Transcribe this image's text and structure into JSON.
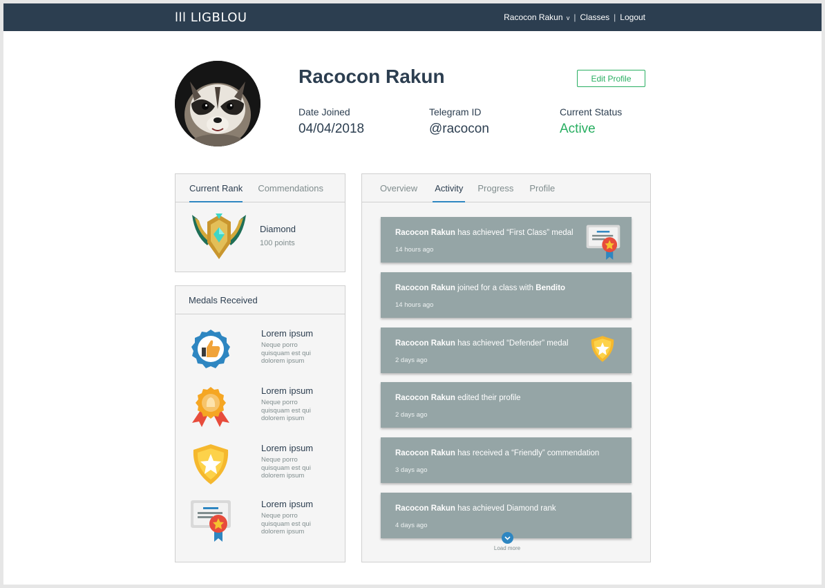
{
  "nav": {
    "logo": "lll LIGBLOU",
    "user_menu": "Racocon Rakun",
    "user_caret": "v",
    "classes": "Classes",
    "logout": "Logout",
    "separator": "|"
  },
  "profile": {
    "name": "Racocon Rakun",
    "edit_label": "Edit Profile",
    "date_joined_label": "Date Joined",
    "date_joined": "04/04/2018",
    "telegram_label": "Telegram ID",
    "telegram": "@racocon",
    "status_label": "Current Status",
    "status": "Active"
  },
  "rank_panel": {
    "tabs": [
      "Current Rank",
      "Commendations"
    ],
    "rank_name": "Diamond",
    "rank_points": "100 points"
  },
  "medals": {
    "title": "Medals Received",
    "items": [
      {
        "title": "Lorem ipsum",
        "desc": "Neque porro quisquam est qui dolorem ipsum",
        "icon": "thumbs-up-badge-icon"
      },
      {
        "title": "Lorem ipsum",
        "desc": "Neque porro quisquam est qui dolorem ipsum",
        "icon": "rosette-ribbon-icon"
      },
      {
        "title": "Lorem ipsum",
        "desc": "Neque porro quisquam est qui dolorem ipsum",
        "icon": "star-shield-icon"
      },
      {
        "title": "Lorem ipsum",
        "desc": "Neque porro quisquam est qui dolorem ipsum",
        "icon": "certificate-icon"
      }
    ]
  },
  "activity": {
    "tabs": [
      "Overview",
      "Activity",
      "Progress",
      "Profile"
    ],
    "active_tab": "Activity",
    "items": [
      {
        "actor": "Racocon Rakun",
        "text": " has achieved “First Class” medal",
        "extra": "",
        "time": "14 hours ago",
        "icon": "certificate-icon"
      },
      {
        "actor": "Racocon Rakun",
        "text": " joined for a class with ",
        "extra": "Bendito",
        "time": "14 hours ago",
        "icon": ""
      },
      {
        "actor": "Racocon Rakun",
        "text": " has achieved “Defender” medal",
        "extra": "",
        "time": "2 days ago",
        "icon": "star-shield-icon"
      },
      {
        "actor": "Racocon Rakun",
        "text": " edited their profile",
        "extra": "",
        "time": "2 days ago",
        "icon": ""
      },
      {
        "actor": "Racocon Rakun",
        "text": " has received a “Friendly” commendation",
        "extra": "",
        "time": "3 days ago",
        "icon": ""
      },
      {
        "actor": "Racocon Rakun",
        "text": " has achieved Diamond rank",
        "extra": "",
        "time": "4 days ago",
        "icon": ""
      }
    ],
    "load_more": "Load more"
  },
  "colors": {
    "navbar": "#2c3e50",
    "accent_green": "#27ae60",
    "accent_blue": "#2e86c1",
    "card_bg": "#95a5a6"
  }
}
